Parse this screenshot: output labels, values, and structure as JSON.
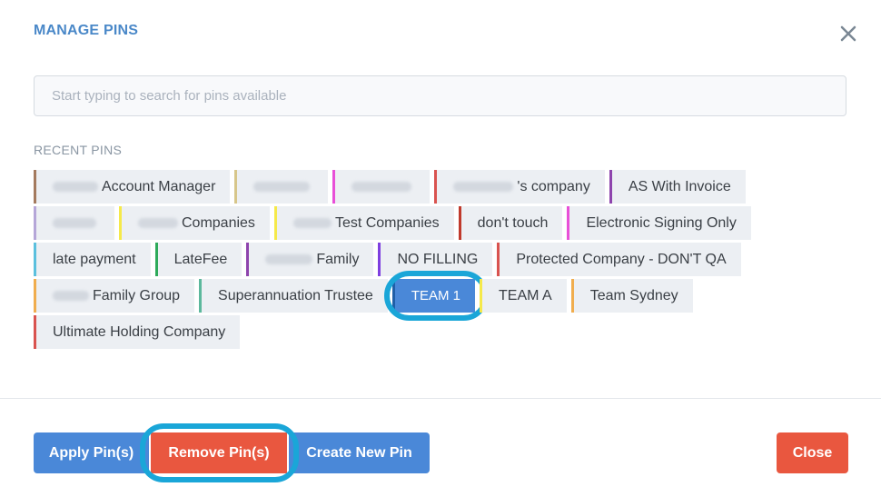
{
  "dialog": {
    "title": "MANAGE PINS",
    "close_icon": "close-icon"
  },
  "search": {
    "placeholder": "Start typing to search for pins available",
    "value": ""
  },
  "recent": {
    "label": "RECENT PINS"
  },
  "pins": [
    {
      "label": "Account Manager",
      "color": "#a47a5e",
      "redacted": true
    },
    {
      "label": "",
      "color": "#d7c68a",
      "redacted": true
    },
    {
      "label": "",
      "color": "#e84fd8",
      "redacted": true
    },
    {
      "label": "'s company",
      "color": "#d9534f",
      "redacted": true
    },
    {
      "label": "AS With Invoice",
      "color": "#8e44ad",
      "redacted": false
    },
    {
      "label": "",
      "color": "#b5a6d8",
      "redacted": true
    },
    {
      "label": "Companies",
      "color": "#f5e94a",
      "redacted": true
    },
    {
      "label": "Test Companies",
      "color": "#f5e94a",
      "redacted": true
    },
    {
      "label": "don't touch",
      "color": "#c0392b",
      "redacted": false
    },
    {
      "label": "Electronic Signing Only",
      "color": "#e84fd8",
      "redacted": false
    },
    {
      "label": "late payment",
      "color": "#5bc0de",
      "redacted": false
    },
    {
      "label": "LateFee",
      "color": "#2eaa5a",
      "redacted": false
    },
    {
      "label": "Family",
      "color": "#8e44ad",
      "redacted": true
    },
    {
      "label": "NO FILLING",
      "color": "#7e3fe0",
      "redacted": false
    },
    {
      "label": "Protected Company - DON'T QA",
      "color": "#d9534f",
      "redacted": false
    },
    {
      "label": "Family Group",
      "color": "#f0ad4e",
      "redacted": true
    },
    {
      "label": "Superannuation Trustee",
      "color": "#5cb89c",
      "redacted": false
    },
    {
      "label": "TEAM 1",
      "color": "#1f5fa8",
      "redacted": false,
      "selected": true
    },
    {
      "label": "TEAM A",
      "color": "#f5e94a",
      "redacted": false
    },
    {
      "label": "Team Sydney",
      "color": "#f0ad4e",
      "redacted": false
    },
    {
      "label": "Ultimate Holding Company",
      "color": "#d9534f",
      "redacted": false
    }
  ],
  "footer": {
    "apply_label": "Apply Pin(s)",
    "remove_label": "Remove Pin(s)",
    "create_label": "Create New Pin",
    "close_label": "Close"
  },
  "colors": {
    "primary": "#4a88d8",
    "danger": "#e9573f",
    "highlight_ring": "#1aa6d8",
    "title": "#4a88c8"
  }
}
